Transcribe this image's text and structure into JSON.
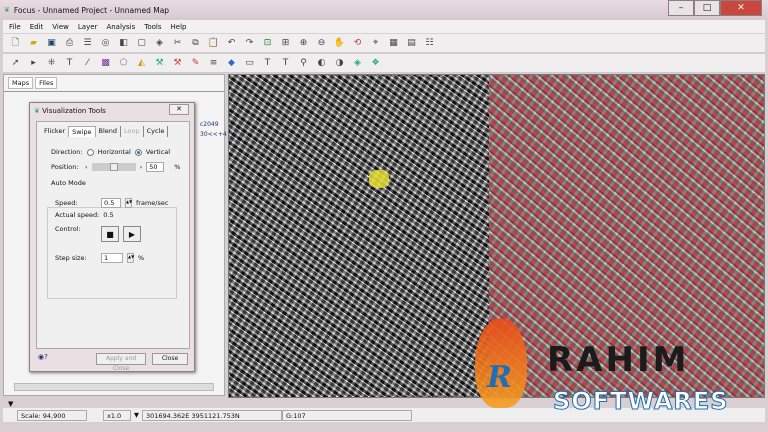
{
  "window": {
    "title": "Focus - Unnamed Project - Unnamed Map",
    "min": "–",
    "max": "□",
    "close": "✕"
  },
  "menu": [
    "File",
    "Edit",
    "View",
    "Layer",
    "Analysis",
    "Tools",
    "Help"
  ],
  "left_panel": {
    "tabs": [
      "Maps",
      "Files"
    ],
    "tree_fragment_1": "c2049",
    "tree_fragment_2": "30<<+4"
  },
  "dialog": {
    "title": "Visualization Tools",
    "close": "✕",
    "tabs": [
      {
        "label": "Flicker"
      },
      {
        "label": "Swipe",
        "active": true
      },
      {
        "label": "Blend"
      },
      {
        "label": "Loop",
        "disabled": true
      },
      {
        "label": "Cycle"
      }
    ],
    "direction_label": "Direction:",
    "horizontal": "Horizontal",
    "vertical": "Vertical",
    "direction_selected": "Vertical",
    "position_label": "Position:",
    "position_value": "50",
    "position_unit": "%",
    "position_slider_percent": 50,
    "auto_mode": "Auto Mode",
    "speed_label": "Speed:",
    "speed_value": "0.5",
    "speed_unit": "frame/sec",
    "actual_speed_label": "Actual speed:",
    "actual_speed_value": "0.5",
    "control_label": "Control:",
    "stop": "■",
    "play": "▶",
    "step_label": "Step size:",
    "step_value": "1",
    "step_unit": "%",
    "apply_close": "Apply and Close",
    "close_btn": "Close",
    "help": "?"
  },
  "status": {
    "scale": "Scale: 94,900",
    "zoom": "x1.0",
    "coords": "301694.362E 3951121.753N",
    "value": "G:107"
  },
  "watermark": {
    "brand": "RAHIM",
    "sub": "SOFTWARES",
    "letter": "R"
  }
}
